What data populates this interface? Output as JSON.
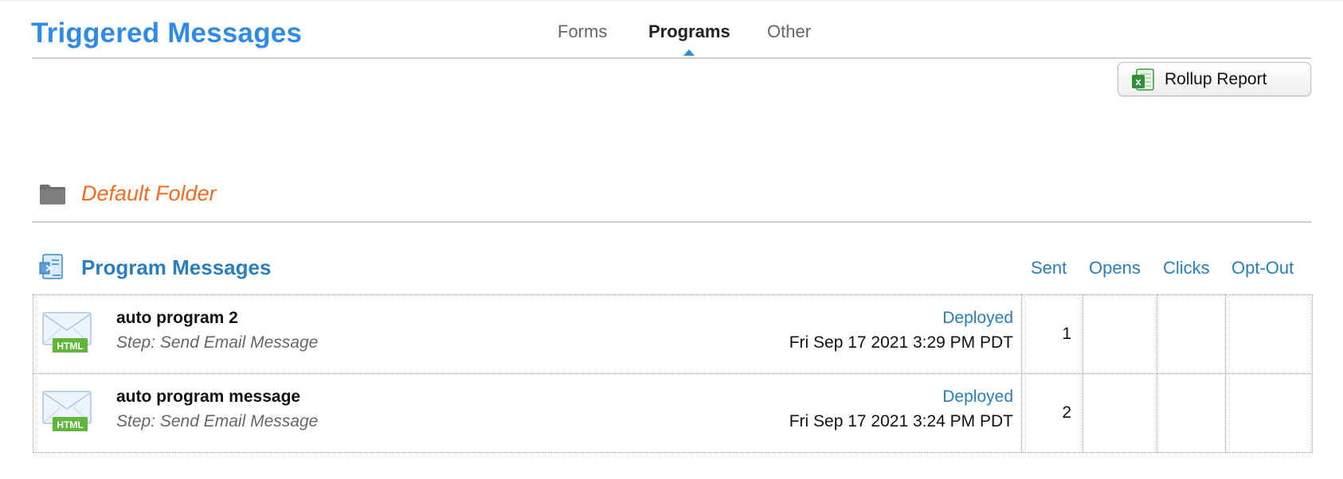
{
  "header": {
    "title": "Triggered Messages",
    "tabs": [
      {
        "label": "Forms",
        "active": false
      },
      {
        "label": "Programs",
        "active": true
      },
      {
        "label": "Other",
        "active": false
      }
    ],
    "accent_color": "#2f8be6"
  },
  "toolbar": {
    "rollup_label": "Rollup Report",
    "rollup_icon": "excel-icon"
  },
  "folder": {
    "name": "Default Folder",
    "icon": "folder-icon",
    "color": "#f26b21"
  },
  "section": {
    "title": "Program Messages",
    "icon": "program-messages-icon",
    "columns": [
      "Sent",
      "Opens",
      "Clicks",
      "Opt-Out"
    ]
  },
  "messages": [
    {
      "name": "auto program 2",
      "step": "Step: Send Email Message",
      "status": "Deployed",
      "date": "Fri Sep 17 2021 3:29 PM PDT",
      "sent": "1",
      "opens": "",
      "clicks": "",
      "optout": "",
      "icon": "html-email-icon"
    },
    {
      "name": "auto program message",
      "step": "Step: Send Email Message",
      "status": "Deployed",
      "date": "Fri Sep 17 2021 3:24 PM PDT",
      "sent": "2",
      "opens": "",
      "clicks": "",
      "optout": "",
      "icon": "html-email-icon"
    }
  ]
}
